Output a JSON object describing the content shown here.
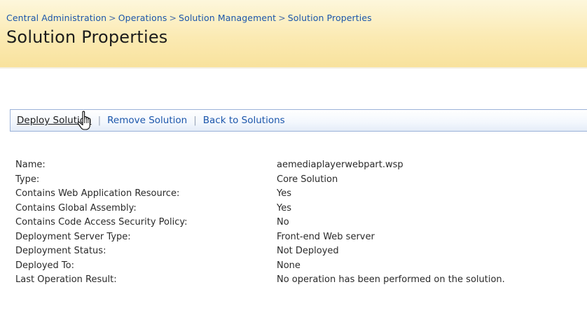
{
  "breadcrumb": {
    "items": [
      "Central Administration",
      "Operations",
      "Solution Management",
      "Solution Properties"
    ],
    "separator": ">"
  },
  "page": {
    "title": "Solution Properties"
  },
  "toolbar": {
    "deploy_label": "Deploy Solution",
    "remove_label": "Remove Solution",
    "back_label": "Back to Solutions",
    "separator": "|"
  },
  "properties": [
    {
      "label": "Name:",
      "value": "aemediaplayerwebpart.wsp"
    },
    {
      "label": "Type:",
      "value": "Core Solution"
    },
    {
      "label": "Contains Web Application Resource:",
      "value": "Yes"
    },
    {
      "label": "Contains Global Assembly:",
      "value": "Yes"
    },
    {
      "label": "Contains Code Access Security Policy:",
      "value": "No"
    },
    {
      "label": "Deployment Server Type:",
      "value": "Front-end Web server"
    },
    {
      "label": "Deployment Status:",
      "value": "Not Deployed"
    },
    {
      "label": "Deployed To:",
      "value": "None"
    },
    {
      "label": "Last Operation Result:",
      "value": "No operation has been performed on the solution."
    }
  ],
  "colors": {
    "header_bg": "#fbeab3",
    "link": "#1b56ab",
    "toolbar_border": "#9bb2d8"
  },
  "icons": {
    "cursor": "hand-pointer-cursor-icon"
  }
}
